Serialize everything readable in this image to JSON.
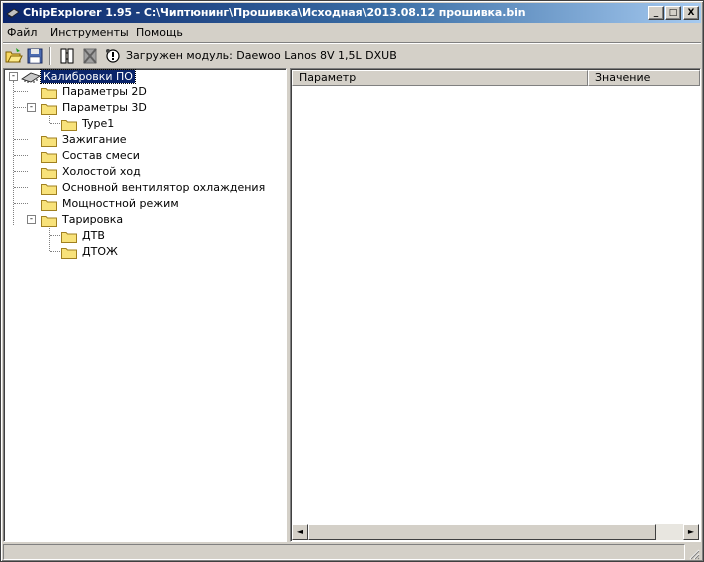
{
  "window": {
    "title": "ChipExplorer  1.95 - C:\\Чиптюнинг\\Прошивка\\Исходная\\2013.08.12 прошивка.bin",
    "minimize_glyph": "_",
    "maximize_glyph": "□",
    "close_glyph": "X"
  },
  "menu": {
    "items": [
      {
        "label": "Файл"
      },
      {
        "label": "Инструменты"
      },
      {
        "label": "Помощь"
      }
    ]
  },
  "toolbar": {
    "icons": [
      "open-folder-icon",
      "save-disk-icon",
      "chip-icon",
      "chip-disabled-icon",
      "info-icon"
    ],
    "module_status": "Загружен модуль: Daewoo Lanos 8V 1,5L DXUB"
  },
  "tree": {
    "root": {
      "label": "Калибровки ПО",
      "expanded": true,
      "selected": true
    },
    "items": [
      {
        "label": "Параметры 2D",
        "level": 1
      },
      {
        "label": "Параметры 3D",
        "level": 1,
        "expanded": true
      },
      {
        "label": "Type1",
        "level": 2
      },
      {
        "label": "Зажигание",
        "level": 1
      },
      {
        "label": "Состав смеси",
        "level": 1
      },
      {
        "label": "Холостой ход",
        "level": 1
      },
      {
        "label": "Основной вентилятор охлаждения",
        "level": 1
      },
      {
        "label": "Мощностной режим",
        "level": 1
      },
      {
        "label": "Тарировка",
        "level": 1,
        "expanded": true
      },
      {
        "label": "ДТВ",
        "level": 2
      },
      {
        "label": "ДТОЖ",
        "level": 2
      }
    ],
    "expander_collapse_glyph": "-"
  },
  "grid": {
    "columns": [
      "Параметр",
      "Значение"
    ],
    "scroll_left_glyph": "◄",
    "scroll_right_glyph": "►"
  },
  "colors": {
    "title_gradient_start": "#0a246a",
    "title_gradient_end": "#a6caf0",
    "selection": "#0a246a",
    "folder": "#f8e27a"
  }
}
